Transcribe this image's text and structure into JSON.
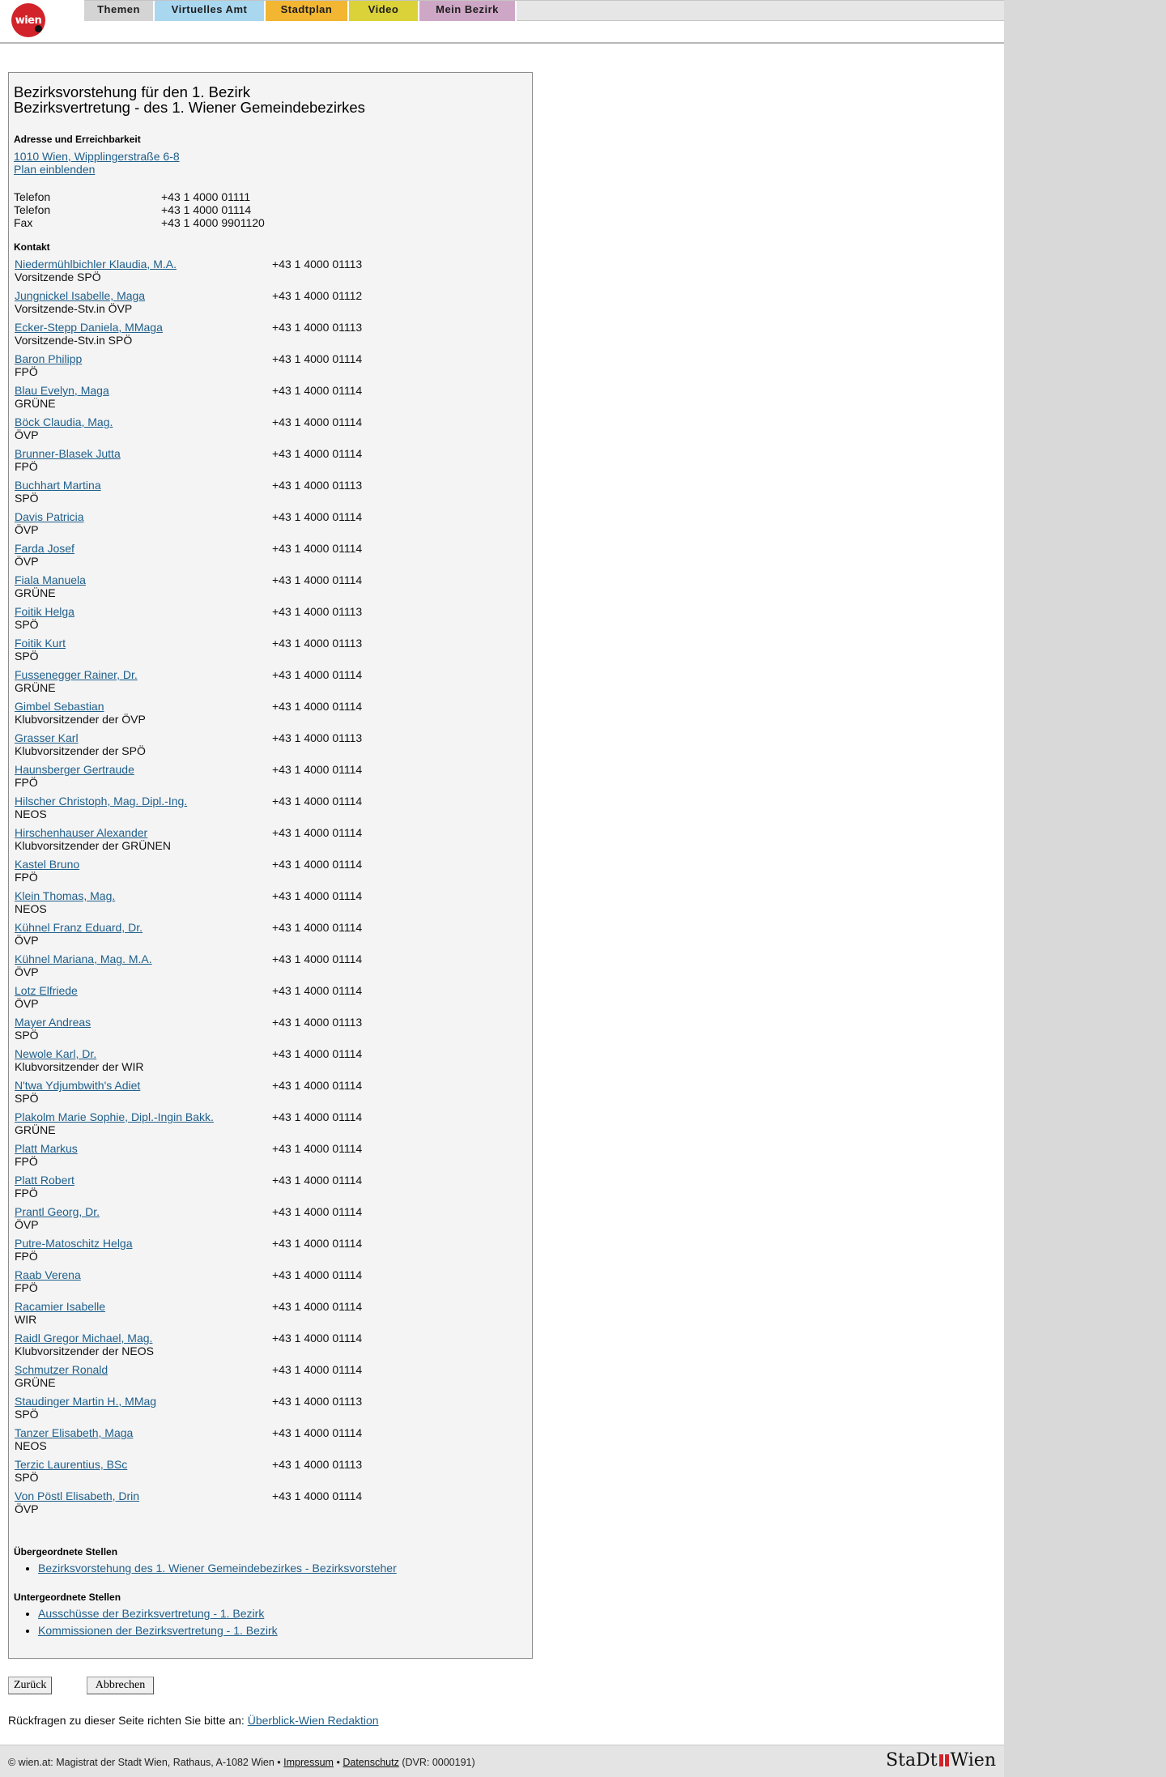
{
  "nav": {
    "logo": "wien",
    "tabs": [
      {
        "label": "Themen",
        "color": "#d4d4d4"
      },
      {
        "label": "Virtuelles Amt",
        "color": "#a9d7ef"
      },
      {
        "label": "Stadtplan",
        "color": "#f2b632"
      },
      {
        "label": "Video",
        "color": "#dbd239"
      },
      {
        "label": "Mein Bezirk",
        "color": "#cfa7c6"
      }
    ]
  },
  "heading": {
    "line1": "Bezirksvorstehung für den 1. Bezirk",
    "line2": "Bezirksvertretung - des 1. Wiener Gemeindebezirkes"
  },
  "address": {
    "title": "Adresse und Erreichbarkeit",
    "street": "1010 Wien, Wipplingerstraße 6-8",
    "plan_link": "Plan einblenden"
  },
  "contact_numbers": [
    {
      "label": "Telefon",
      "value": "+43 1 4000 01111"
    },
    {
      "label": "Telefon",
      "value": "+43 1 4000 01114"
    },
    {
      "label": "Fax",
      "value": "+43 1 4000 9901120"
    }
  ],
  "kontakt_title": "Kontakt",
  "members": [
    {
      "name": "Niedermühlbichler Klaudia, M.A.",
      "role": "Vorsitzende SPÖ",
      "phone": "+43 1 4000 01113"
    },
    {
      "name": "Jungnickel Isabelle, Maga",
      "role": "Vorsitzende-Stv.in ÖVP",
      "phone": "+43 1 4000 01112"
    },
    {
      "name": "Ecker-Stepp Daniela, MMaga",
      "role": "Vorsitzende-Stv.in SPÖ",
      "phone": "+43 1 4000 01113"
    },
    {
      "name": "Baron Philipp",
      "role": "FPÖ",
      "phone": "+43 1 4000 01114"
    },
    {
      "name": "Blau Evelyn, Maga",
      "role": "GRÜNE",
      "phone": "+43 1 4000 01114"
    },
    {
      "name": "Böck Claudia, Mag.",
      "role": "ÖVP",
      "phone": "+43 1 4000 01114"
    },
    {
      "name": "Brunner-Blasek Jutta",
      "role": "FPÖ",
      "phone": "+43 1 4000 01114"
    },
    {
      "name": "Buchhart Martina",
      "role": "SPÖ",
      "phone": "+43 1 4000 01113"
    },
    {
      "name": "Davis Patricia",
      "role": "ÖVP",
      "phone": "+43 1 4000 01114"
    },
    {
      "name": "Farda Josef",
      "role": "ÖVP",
      "phone": "+43 1 4000 01114"
    },
    {
      "name": "Fiala Manuela",
      "role": "GRÜNE",
      "phone": "+43 1 4000 01114"
    },
    {
      "name": "Foitik Helga",
      "role": "SPÖ",
      "phone": "+43 1 4000 01113"
    },
    {
      "name": "Foitik Kurt",
      "role": "SPÖ",
      "phone": "+43 1 4000 01113"
    },
    {
      "name": "Fussenegger Rainer, Dr.",
      "role": "GRÜNE",
      "phone": "+43 1 4000 01114"
    },
    {
      "name": "Gimbel Sebastian",
      "role": "Klubvorsitzender der ÖVP",
      "phone": "+43 1 4000 01114"
    },
    {
      "name": "Grasser Karl",
      "role": "Klubvorsitzender der SPÖ",
      "phone": "+43 1 4000 01113"
    },
    {
      "name": "Haunsberger Gertraude",
      "role": "FPÖ",
      "phone": "+43 1 4000 01114"
    },
    {
      "name": "Hilscher Christoph, Mag. Dipl.-Ing.",
      "role": "NEOS",
      "phone": "+43 1 4000 01114"
    },
    {
      "name": "Hirschenhauser Alexander",
      "role": "Klubvorsitzender der GRÜNEN",
      "phone": "+43 1 4000 01114"
    },
    {
      "name": "Kastel Bruno",
      "role": "FPÖ",
      "phone": "+43 1 4000 01114"
    },
    {
      "name": "Klein Thomas, Mag.",
      "role": "NEOS",
      "phone": "+43 1 4000 01114"
    },
    {
      "name": "Kühnel Franz Eduard, Dr.",
      "role": "ÖVP",
      "phone": "+43 1 4000 01114"
    },
    {
      "name": "Kühnel Mariana, Mag. M.A.",
      "role": "ÖVP",
      "phone": "+43 1 4000 01114"
    },
    {
      "name": "Lotz Elfriede",
      "role": "ÖVP",
      "phone": "+43 1 4000 01114"
    },
    {
      "name": "Mayer Andreas",
      "role": "SPÖ",
      "phone": "+43 1 4000 01113"
    },
    {
      "name": "Newole Karl, Dr.",
      "role": "Klubvorsitzender der WIR",
      "phone": "+43 1 4000 01114"
    },
    {
      "name": "N'twa Ydjumbwith's Adiet",
      "role": "SPÖ",
      "phone": "+43 1 4000 01114"
    },
    {
      "name": "Plakolm Marie Sophie, Dipl.-Ingin Bakk.",
      "role": "GRÜNE",
      "phone": "+43 1 4000 01114"
    },
    {
      "name": "Platt Markus",
      "role": "FPÖ",
      "phone": "+43 1 4000 01114"
    },
    {
      "name": "Platt Robert",
      "role": "FPÖ",
      "phone": "+43 1 4000 01114"
    },
    {
      "name": "Prantl Georg, Dr.",
      "role": "ÖVP",
      "phone": "+43 1 4000 01114"
    },
    {
      "name": "Putre-Matoschitz Helga",
      "role": "FPÖ",
      "phone": "+43 1 4000 01114"
    },
    {
      "name": "Raab Verena",
      "role": "FPÖ",
      "phone": "+43 1 4000 01114"
    },
    {
      "name": "Racamier Isabelle",
      "role": "WIR",
      "phone": "+43 1 4000 01114"
    },
    {
      "name": "Raidl Gregor Michael, Mag.",
      "role": "Klubvorsitzender der NEOS",
      "phone": "+43 1 4000 01114"
    },
    {
      "name": "Schmutzer Ronald",
      "role": "GRÜNE",
      "phone": "+43 1 4000 01114"
    },
    {
      "name": "Staudinger Martin H., MMag",
      "role": "SPÖ",
      "phone": "+43 1 4000 01113"
    },
    {
      "name": "Tanzer Elisabeth, Maga",
      "role": "NEOS",
      "phone": "+43 1 4000 01114"
    },
    {
      "name": "Terzic Laurentius, BSc",
      "role": "SPÖ",
      "phone": "+43 1 4000 01113"
    },
    {
      "name": "Von Pöstl Elisabeth, Drin",
      "role": "ÖVP",
      "phone": "+43 1 4000 01114"
    }
  ],
  "uebergeordnet": {
    "title": "Übergeordnete Stellen",
    "links": [
      "Bezirksvorstehung des 1. Wiener Gemeindebezirkes - Bezirksvorsteher"
    ]
  },
  "untergeordnet": {
    "title": "Untergeordnete Stellen",
    "links": [
      "Ausschüsse der Bezirksvertretung - 1. Bezirk",
      "Kommissionen der Bezirksvertretung - 1. Bezirk"
    ]
  },
  "buttons": {
    "back": "Zurück",
    "cancel": "Abbrechen"
  },
  "feedback": {
    "text": "Rückfragen zu dieser Seite richten Sie bitte an:",
    "link": "Überblick-Wien Redaktion"
  },
  "footer": {
    "text": "© wien.at: Magistrat der Stadt Wien, Rathaus, A-1082 Wien •",
    "impressum": "Impressum",
    "sep": "•",
    "datenschutz": "Datenschutz",
    "dvr": "(DVR: 0000191)",
    "logo_left": "StaDt",
    "logo_right": "Wien"
  }
}
